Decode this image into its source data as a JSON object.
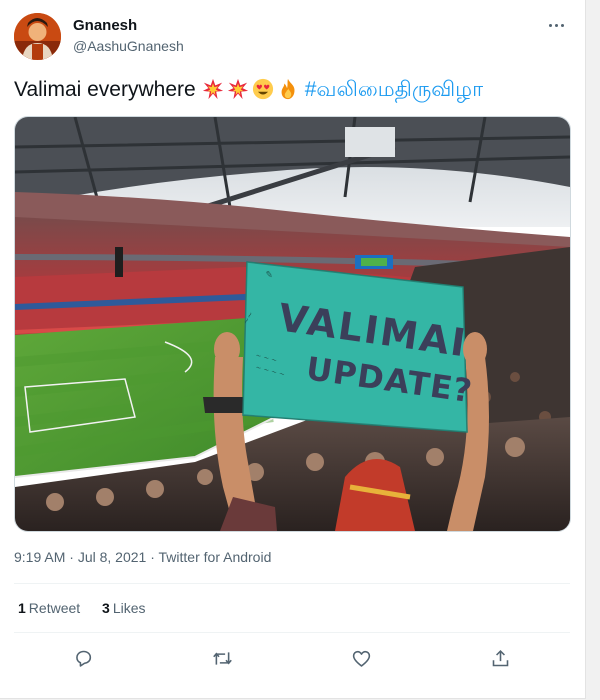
{
  "user": {
    "name": "Gnanesh",
    "handle": "@AashuGnanesh"
  },
  "tweet": {
    "text": "Valimai everywhere",
    "emojis": [
      "collision-icon",
      "collision-icon",
      "heart-eyes-icon",
      "fire-icon"
    ],
    "hashtag": "#வலிமைதிருவிழா"
  },
  "media": {
    "sign_line1": "VALIMAI",
    "sign_line2": "UPDATE?"
  },
  "meta": {
    "time": "9:19 AM",
    "sep1": " · ",
    "date": "Jul 8, 2021",
    "sep2": " · ",
    "source": "Twitter for Android"
  },
  "stats": {
    "retweets_count": "1",
    "retweets_label": "Retweet",
    "likes_count": "3",
    "likes_label": "Likes"
  },
  "actions": [
    "reply-icon",
    "retweet-icon",
    "like-icon",
    "share-icon"
  ],
  "colors": {
    "hashtag": "#1d9bf0",
    "secondary_text": "#536471",
    "sign": "#2ab3a1"
  }
}
